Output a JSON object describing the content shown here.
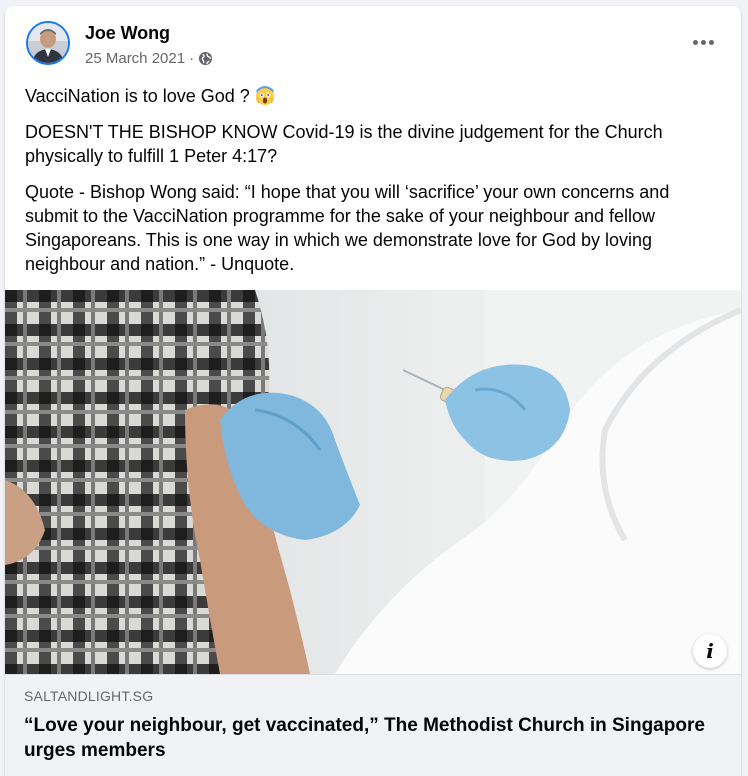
{
  "post": {
    "author": "Joe Wong",
    "date": "25 March 2021",
    "separator": "·",
    "privacy_icon": "globe-icon",
    "menu_icon": "more-options-icon"
  },
  "body": {
    "line1": "VacciNation is to love God ?",
    "line1_emoji": "screaming-face-emoji",
    "para2": "DOESN'T THE BISHOP KNOW Covid-19 is the divine judgement for the Church physically to fulfill 1 Peter 4:17?",
    "para3": "Quote - Bishop Wong said: “I hope that you will ‘sacrifice’ your own concerns and submit to the VacciNation programme for the sake of your neighbour and fellow Singaporeans. This is one way in which we demonstrate love for God by loving neighbour and nation.” - Unquote."
  },
  "link": {
    "domain": "SALTANDLIGHT.SG",
    "title": "“Love your neighbour, get vaccinated,” The Methodist Church in Singapore urges members",
    "info_label": "i"
  },
  "colors": {
    "accent": "#1877f2",
    "secondary_text": "#65676b",
    "preview_bg": "#f0f2f5"
  }
}
